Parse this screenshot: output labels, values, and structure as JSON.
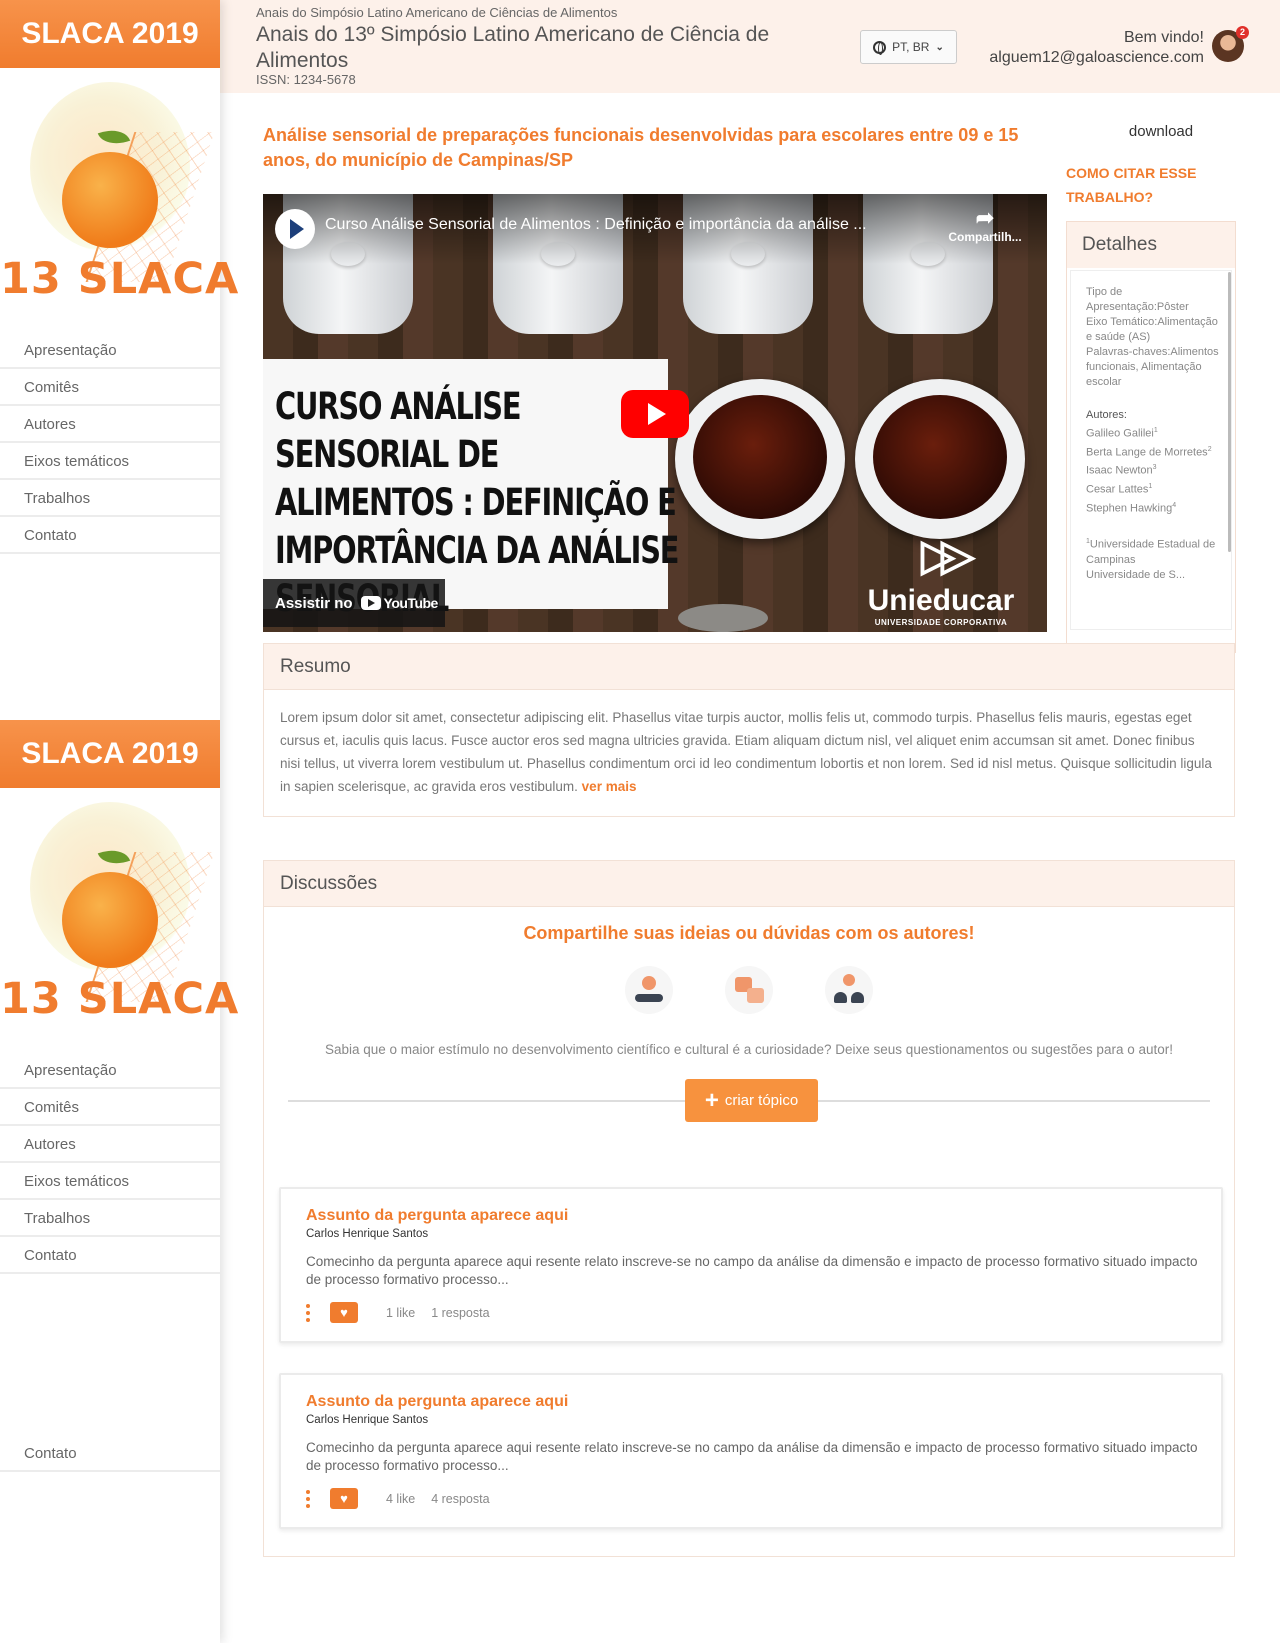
{
  "sidebar": {
    "banner": "SLACA 2019",
    "logo_text": "13 SLACA",
    "nav": [
      "Apresentação",
      "Comitês",
      "Autores",
      "Eixos temáticos",
      "Trabalhos",
      "Contato"
    ],
    "extra_item": "Contato"
  },
  "header": {
    "supertitle": "Anais do Simpósio Latino Americano de Ciências de Alimentos",
    "title": "Anais do 13º Simpósio Latino Americano de Ciência de Alimentos",
    "issn": "ISSN: 1234-5678",
    "language": "PT, BR",
    "welcome": "Bem vindo!",
    "user_email": "alguem12@galoascience.com",
    "notification_count": "2"
  },
  "paper": {
    "title": "Análise sensorial de preparações funcionais desenvolvidas para escolares entre 09 e 15 anos, do município de Campinas/SP"
  },
  "video": {
    "title": "Curso Análise Sensorial de Alimentos : Definição e importância da análise ...",
    "share_label": "Compartilh...",
    "card_text": "Curso Análise Sensorial de Alimentos : Definição e importância da análise sensorial",
    "watch_label": "Assistir no",
    "youtube_label": "YouTube",
    "brand_name": "Unieducar",
    "brand_sub": "UNIVERSIDADE CORPORATIVA"
  },
  "aside": {
    "download": "download",
    "cite": "COMO CITAR ESSE TRABALHO?",
    "details_title": "Detalhes",
    "tipo": "Tipo de Apresentação:Pôster",
    "eixo": "Eixo Temático:Alimentação e saúde (AS)",
    "palavras": "Palavras-chaves:Alimentos funcionais, Alimentação escolar",
    "authors_label": "Autores:",
    "authors": [
      {
        "name": "Galileo Galilei",
        "sup": "1"
      },
      {
        "name": "Berta Lange de Morretes",
        "sup": "2"
      },
      {
        "name": "Isaac Newton",
        "sup": "3"
      },
      {
        "name": "Cesar Lattes",
        "sup": "1"
      },
      {
        "name": "Stephen Hawking",
        "sup": "4"
      }
    ],
    "affiliation_sup": "1",
    "affiliation": "Universidade Estadual de Campinas",
    "affiliation2": "Universidade de S..."
  },
  "resumo": {
    "title": "Resumo",
    "text": "Lorem ipsum dolor sit amet, consectetur adipiscing elit. Phasellus vitae turpis auctor, mollis felis ut, commodo turpis. Phasellus felis mauris, egestas eget cursus et, iaculis quis lacus. Fusce auctor eros sed magna ultricies gravida. Etiam aliquam dictum nisl, vel aliquet enim accumsan sit amet. Donec finibus nisi tellus, ut viverra lorem vestibulum ut. Phasellus condimentum orci id leo condimentum lobortis et non lorem. Sed id nisl metus. Quisque sollicitudin ligula in sapien scelerisque, ac gravida eros vestibulum.",
    "more": "ver mais"
  },
  "discussions": {
    "title": "Discussões",
    "cta": "Compartilhe suas ideias ou dúvidas com os autores!",
    "icons": [
      "seedling-hand-icon",
      "question-answer-icon",
      "group-icon"
    ],
    "text": "Sabia que o maior estímulo no desenvolvimento científico e cultural é a curiosidade? Deixe seus questionamentos ou sugestões para o autor!",
    "new_topic": "criar tópico",
    "topics": [
      {
        "title": "Assunto da pergunta aparece aqui",
        "author": "Carlos Henrique Santos",
        "text": "Comecinho da pergunta aparece aqui resente relato inscreve-se no campo da análise da dimensão e impacto de processo formativo situado impacto de processo formativo processo...",
        "likes": "1 like",
        "replies": "1 resposta"
      },
      {
        "title": "Assunto da pergunta aparece aqui",
        "author": "Carlos Henrique Santos",
        "text": "Comecinho da pergunta aparece aqui resente relato inscreve-se no campo da análise da dimensão e impacto de processo formativo situado impacto de processo formativo processo...",
        "likes": "4 like",
        "replies": "4 resposta"
      }
    ]
  },
  "colors": {
    "accent": "#f07c2e",
    "header_bg": "#fdf1ea"
  }
}
